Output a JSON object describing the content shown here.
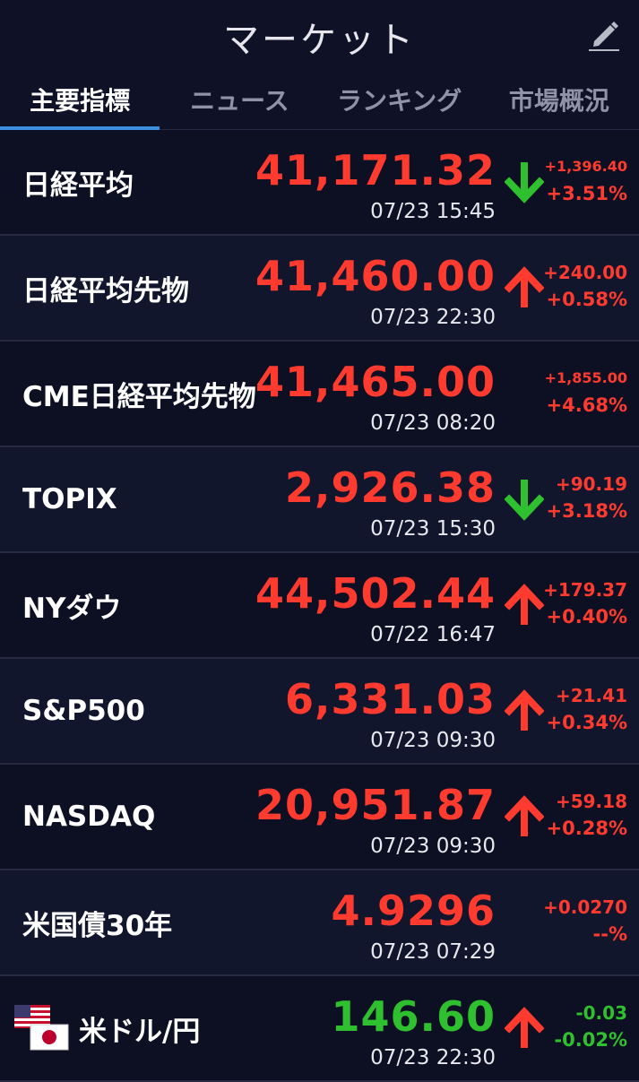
{
  "header": {
    "title": "マーケット"
  },
  "tabs": [
    {
      "label": "主要指標",
      "active": true
    },
    {
      "label": "ニュース",
      "active": false
    },
    {
      "label": "ランキング",
      "active": false
    },
    {
      "label": "市場概況",
      "active": false
    }
  ],
  "rows": [
    {
      "name": "日経平均",
      "price": "41,171.32",
      "time": "07/23 15:45",
      "change": "+1,396.40",
      "pct": "+3.51%",
      "arrow": "down"
    },
    {
      "name": "日経平均先物",
      "price": "41,460.00",
      "time": "07/23 22:30",
      "change": "+240.00",
      "pct": "+0.58%",
      "arrow": "up"
    },
    {
      "name": "CME日経平均先物",
      "price": "41,465.00",
      "time": "07/23 08:20",
      "change": "+1,855.00",
      "pct": "+4.68%",
      "arrow": "none"
    },
    {
      "name": "TOPIX",
      "price": "2,926.38",
      "time": "07/23 15:30",
      "change": "+90.19",
      "pct": "+3.18%",
      "arrow": "down"
    },
    {
      "name": "NYダウ",
      "price": "44,502.44",
      "time": "07/22 16:47",
      "change": "+179.37",
      "pct": "+0.40%",
      "arrow": "up"
    },
    {
      "name": "S&P500",
      "price": "6,331.03",
      "time": "07/23 09:30",
      "change": "+21.41",
      "pct": "+0.34%",
      "arrow": "up"
    },
    {
      "name": "NASDAQ",
      "price": "20,951.87",
      "time": "07/23 09:30",
      "change": "+59.18",
      "pct": "+0.28%",
      "arrow": "up"
    },
    {
      "name": "米国債30年",
      "price": "4.9296",
      "time": "07/23 07:29",
      "change": "+0.0270",
      "pct": "--%",
      "arrow": "none"
    },
    {
      "name": "米ドル/円",
      "price": "146.60",
      "time": "07/23 22:30",
      "change": "-0.03",
      "pct": "-0.02%",
      "arrow": "up"
    }
  ],
  "colors": {
    "background": "#0f1226",
    "up_red": "#ff3b30",
    "down_green": "#2ec02e",
    "tab_accent": "#3b8fe0"
  },
  "icons": {
    "edit": "pencil-icon",
    "arrow_up": "arrow-up-icon",
    "arrow_down": "arrow-down-icon",
    "flags": "us-japan-flags-icon"
  }
}
